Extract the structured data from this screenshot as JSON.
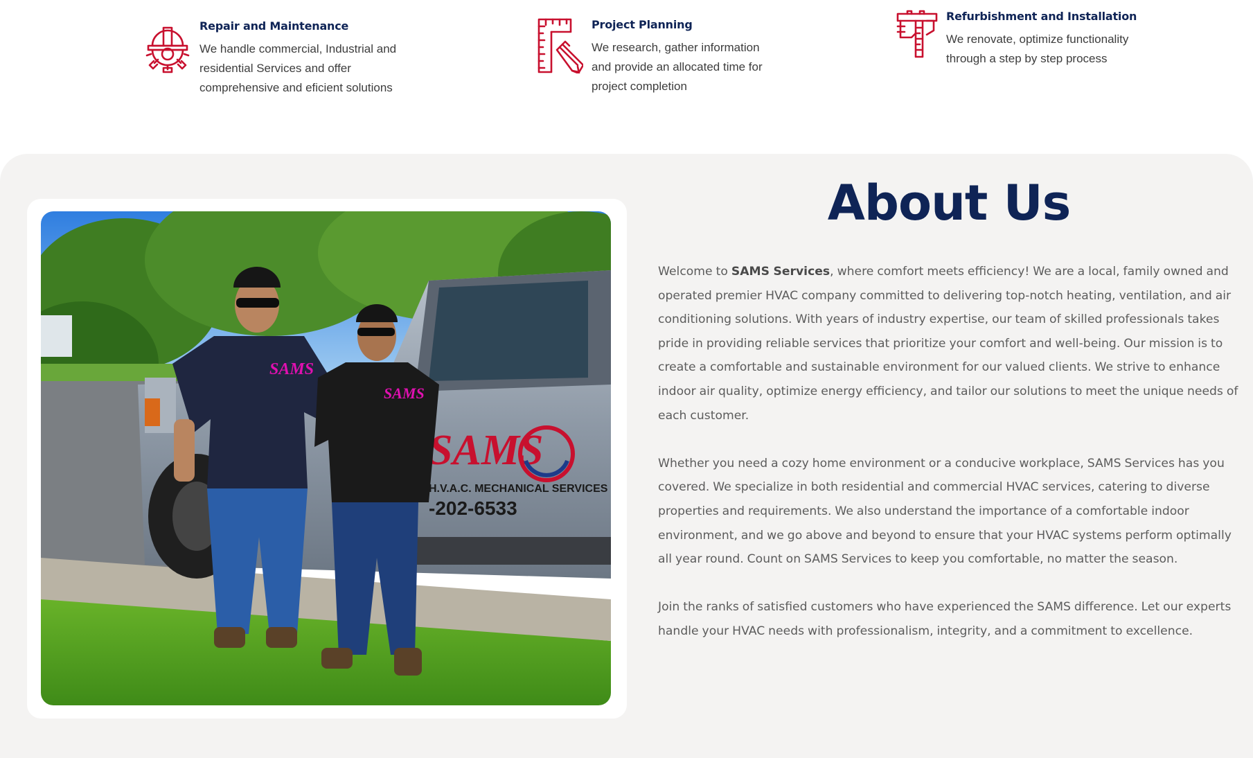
{
  "features": [
    {
      "icon": "hard-hat-gear-icon",
      "title": "Repair and Maintenance",
      "text": "We handle commercial, Industrial and residential Services and offer comprehensive and eficient solutions"
    },
    {
      "icon": "ruler-pencil-icon",
      "title": "Project Planning",
      "text": "We research, gather information and provide an allocated time for project completion"
    },
    {
      "icon": "caliper-icon",
      "title": "Refurbishment and Installation",
      "text": "We renovate, optimize functionality through a step by step process"
    }
  ],
  "about": {
    "title": "About Us",
    "paragraph1": {
      "prefix": "Welcome to ",
      "brand": "SAMS Services",
      "suffix": ", where comfort meets efficiency! We are a local, family owned and operated premier HVAC company committed to delivering top-notch heating, ventilation, and air conditioning solutions. With years of industry expertise, our team of skilled professionals takes pride in providing reliable services that prioritize your comfort and well-being. Our mission is to create a comfortable and sustainable environment for our valued clients. We strive to enhance indoor air quality, optimize energy efficiency, and tailor our solutions to meet the unique needs of each customer."
    },
    "paragraph2": "Whether you need a cozy home environment or a conducive workplace, SAMS Services has you covered. We specialize in both residential and commercial HVAC services, catering to diverse properties and requirements. We also understand the importance of a comfortable indoor environment, and we go above and beyond to ensure that your HVAC systems perform optimally all year round. Count on SAMS Services to keep you comfortable, no matter the season.",
    "paragraph3": "Join the ranks of satisfied customers who have experienced the SAMS difference. Let our experts handle your HVAC needs with professionalism, integrity, and a commitment to excellence.",
    "photo": {
      "truck_logo": "SAMS",
      "truck_subtitle": "H.V.A.C. MECHANICAL SERVICES",
      "truck_phone": "-202-6533",
      "shirt_logo": "SAMS"
    }
  },
  "colors": {
    "accent_red": "#c8102e",
    "navy": "#0f2456",
    "section_bg": "#f4f3f2",
    "body_text": "#5c5c5c"
  }
}
